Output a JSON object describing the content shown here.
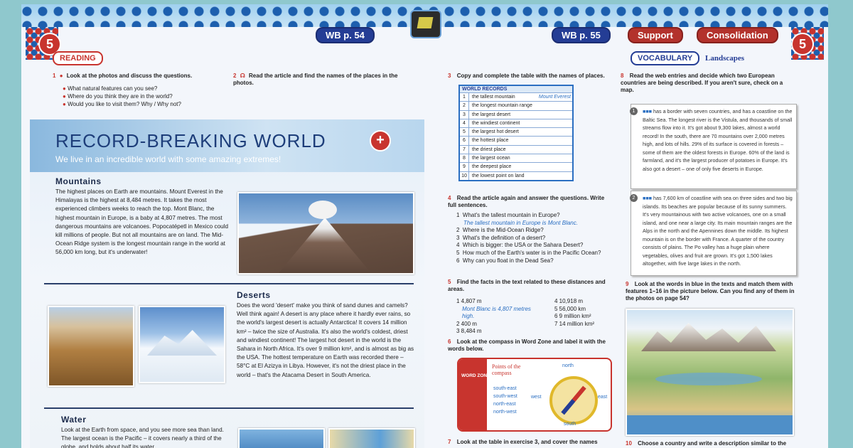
{
  "header": {
    "unit_left": "5",
    "unit_right": "5",
    "wb_left": "WB p. 54",
    "wb_right": "WB p. 55",
    "support": "Support",
    "consolidation": "Consolidation"
  },
  "left": {
    "reading_tag": "READING",
    "ex1": {
      "num": "1",
      "prompt": "Look at the photos and discuss the questions.",
      "bullets": [
        "What natural features can you see?",
        "Where do you think they are in the world?",
        "Would you like to visit them? Why / Why not?"
      ]
    },
    "ex2": {
      "num": "2",
      "prompt": "Read the article and find the names of the places in the photos."
    },
    "article": {
      "title": "RECORD-BREAKING WORLD",
      "subtitle": "We live in an incredible world with some amazing extremes!",
      "plus": "+",
      "mountains_head": "Mountains",
      "mountains_text": "The highest places on Earth are mountains. Mount Everest in the Himalayas is the highest at 8,484 metres. It takes the most experienced climbers weeks to reach the top. Mont Blanc, the highest mountain in Europe, is a baby at 4,807 metres. The most dangerous mountains are volcanoes. Popocatépetl in Mexico could kill millions of people. But not all mountains are on land. The Mid-Ocean Ridge system is the longest mountain range in the world at 56,000 km long, but it's underwater!",
      "deserts_head": "Deserts",
      "deserts_text": "Does the word 'desert' make you think of sand dunes and camels? Well think again! A desert is any place where it hardly ever rains, so the world's largest desert is actually Antarctica! It covers 14 million km² – twice the size of Australia. It's also the world's coldest, driest and windiest continent! The largest hot desert in the world is the Sahara in North Africa. It's over 9 million km², and is almost as big as the USA. The hottest temperature on Earth was recorded there – 58°C at El Azizya in Libya. However, it's not the driest place in the world – that's the Atacama Desert in South America.",
      "water_head": "Water",
      "water_text": "Look at the Earth from space, and you see more sea than land. The largest ocean is the Pacific – it covers nearly a third of the globe, and holds about half its water."
    }
  },
  "middle": {
    "ex3": {
      "num": "3",
      "prompt": "Copy and complete the table with the names of places."
    },
    "table_title": "WORLD RECORDS",
    "table_rows": [
      {
        "n": "1",
        "label": "the tallest mountain",
        "answer": "Mount Everest"
      },
      {
        "n": "2",
        "label": "the longest mountain range",
        "answer": ""
      },
      {
        "n": "3",
        "label": "the largest desert",
        "answer": ""
      },
      {
        "n": "4",
        "label": "the windiest continent",
        "answer": ""
      },
      {
        "n": "5",
        "label": "the largest hot desert",
        "answer": ""
      },
      {
        "n": "6",
        "label": "the hottest place",
        "answer": ""
      },
      {
        "n": "7",
        "label": "the driest place",
        "answer": ""
      },
      {
        "n": "8",
        "label": "the largest ocean",
        "answer": ""
      },
      {
        "n": "9",
        "label": "the deepest place",
        "answer": ""
      },
      {
        "n": "10",
        "label": "the lowest point on land",
        "answer": ""
      }
    ],
    "ex4": {
      "num": "4",
      "prompt": "Read the article again and answer the questions. Write full sentences.",
      "questions": [
        {
          "n": "1",
          "q": "What's the tallest mountain in Europe?"
        },
        {
          "n": "2",
          "q": "Where is the Mid-Ocean Ridge?"
        },
        {
          "n": "3",
          "q": "What's the definition of a desert?"
        },
        {
          "n": "4",
          "q": "Which is bigger: the USA or the Sahara Desert?"
        },
        {
          "n": "5",
          "q": "How much of the Earth's water is in the Pacific Ocean?"
        },
        {
          "n": "6",
          "q": "Why can you float in the Dead Sea?"
        }
      ],
      "example_answer": "The tallest mountain in Europe is Mont Blanc."
    },
    "ex5": {
      "num": "5",
      "prompt": "Find the facts in the text related to these distances and areas.",
      "left": [
        "1  4,807 m",
        "2  400 m",
        "3  8,484 m"
      ],
      "example": "Mont Blanc is 4,807 metres high.",
      "right": [
        "4  10,918 m",
        "5  56,000 km",
        "6  9 million km²",
        "7  14 million km²"
      ]
    },
    "ex6": {
      "num": "6",
      "prompt": "Look at the compass in Word Zone and label it with the words below.",
      "wordzone": "WORD ZONE",
      "box_title": "Points of the compass",
      "words": [
        "south-east",
        "south-west",
        "north-east",
        "north-west"
      ],
      "north": "north",
      "south": "south",
      "east": "east",
      "west": "west"
    },
    "ex7": {
      "num": "7",
      "prompt": "Look at the table in exercise 3, and cover the names"
    }
  },
  "right": {
    "vocab_tag": "VOCABULARY",
    "vocab_title": "Landscapes",
    "ex8": {
      "num": "8",
      "prompt": "Read the web entries and decide which two European countries are being described. If you aren't sure, check on a map."
    },
    "entry1": {
      "num": "1",
      "text": "has a border with seven countries, and has a coastline on the Baltic Sea. The longest river is the Vistula, and thousands of small streams flow into it. It's got about 9,300 lakes, almost a world record! In the south, there are 70 mountains over 2,000 metres high, and lots of hills. 29% of its surface is covered in forests – some of them are the oldest forests in Europe. 60% of the land is farmland, and it's the largest producer of potatoes in Europe. It's also got a desert – one of only five deserts in Europe."
    },
    "entry2": {
      "num": "2",
      "text": "has 7,600 km of coastline with sea on three sides and two big islands. Its beaches are popular because of its sunny summers. It's very mountainous with two active volcanoes, one on a small island, and one near a large city. Its main mountain ranges are the Alps in the north and the Apennines down the middle. Its highest mountain is on the border with France. A quarter of the country consists of plains. The Po valley has a huge plain where vegetables, olives and fruit are grown. It's got 1,500 lakes altogether, with five large lakes in the north."
    },
    "ex9": {
      "num": "9",
      "prompt": "Look at the words in blue in the texts and match them with features 1–16 in the picture below. Can you find any of them in the photos on page 54?"
    },
    "ex10": {
      "num": "10",
      "prompt": "Choose a country and write a description similar to the"
    }
  },
  "colors": {
    "red": "#c8342e",
    "navy": "#243d95",
    "link_blue": "#2b6fc2"
  }
}
